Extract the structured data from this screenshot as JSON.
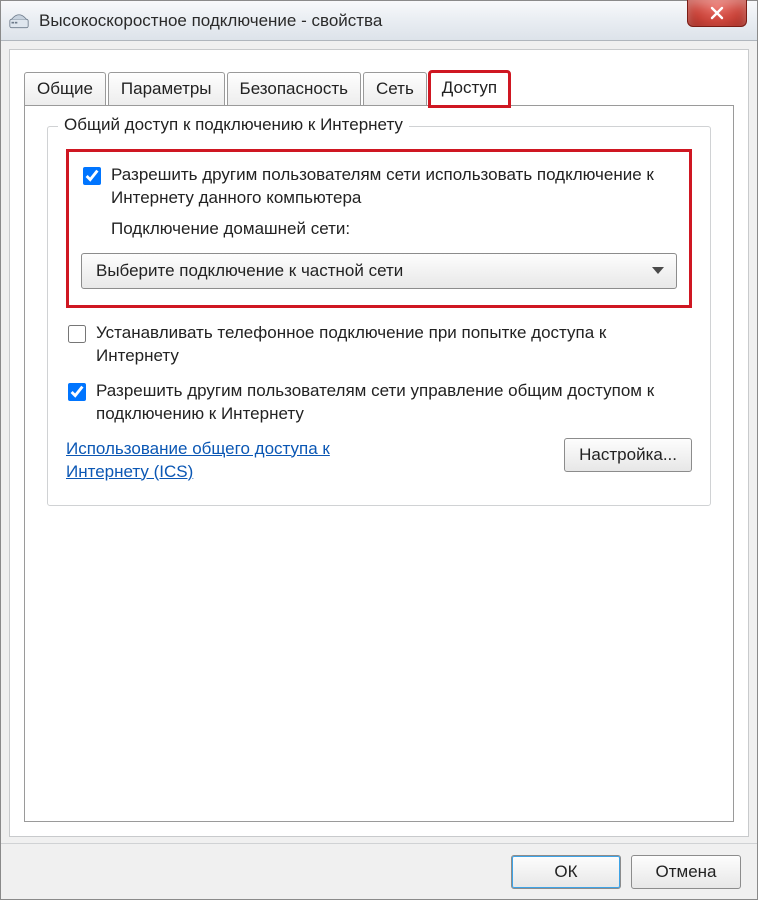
{
  "window": {
    "title": "Высокоскоростное подключение - свойства",
    "close_tooltip": "Закрыть"
  },
  "tabs": {
    "general": "Общие",
    "params": "Параметры",
    "security": "Безопасность",
    "network": "Сеть",
    "sharing": "Доступ"
  },
  "group": {
    "legend": "Общий доступ к подключению к Интернету",
    "allow_share": "Разрешить другим пользователям сети использовать подключение к Интернету данного компьютера",
    "home_conn_label": "Подключение домашней сети:",
    "dropdown_value": "Выберите подключение к частной сети",
    "dial_on_demand": "Устанавливать телефонное подключение при попытке доступа к Интернету",
    "allow_control": "Разрешить другим пользователям сети управление общим доступом к подключению к Интернету",
    "ics_link": "Использование общего доступа к Интернету (ICS)",
    "settings_btn": "Настройка..."
  },
  "footer": {
    "ok": "ОК",
    "cancel": "Отмена"
  }
}
